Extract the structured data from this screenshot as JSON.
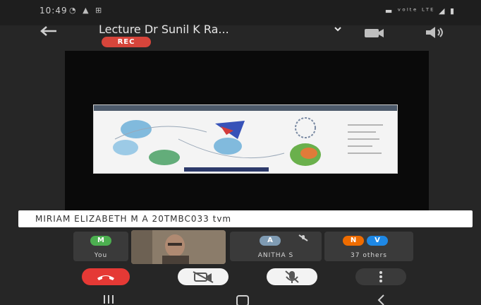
{
  "status": {
    "time": "10:49",
    "left_icons": "◔ ▲ ⊞",
    "right_icons": "▬ ᵛᵒˡᵗᵉ ᴸᵀᴱ ◢ ▮"
  },
  "header": {
    "title": "Lecture Dr Sunil K Ra...",
    "rec_label": "REC",
    "icons": [
      "back-arrow-icon",
      "chevron-down-icon",
      "camera-switch-icon",
      "speaker-icon"
    ]
  },
  "caption": "MIRIAM ELIZABETH M A 20TMBC033 tvm",
  "participants": [
    {
      "initial": "M",
      "label": "You",
      "color": "#4caf50"
    },
    {
      "initial": "A",
      "label": "ANITHA S",
      "color": "#7f9bb3"
    }
  ],
  "others": {
    "initials": [
      "N",
      "V"
    ],
    "label": "37 others",
    "colors": [
      "#ef6c00",
      "#1e88e5"
    ]
  },
  "controls": [
    "end-call-icon",
    "camera-off-icon",
    "mic-off-icon",
    "more-options-icon"
  ],
  "colors": {
    "rec": "#d6453b",
    "end_call": "#e53935",
    "background": "#262626"
  },
  "nav": [
    "menu-icon",
    "home-icon",
    "back-icon"
  ]
}
